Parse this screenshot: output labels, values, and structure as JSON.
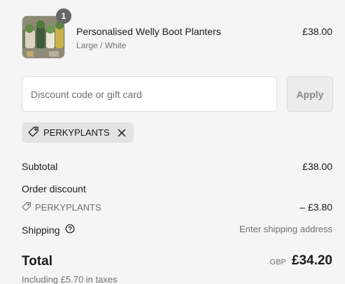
{
  "product": {
    "quantity": "1",
    "title": "Personalised Welly Boot Planters",
    "variant": "Large / White",
    "price": "£38.00"
  },
  "discount": {
    "placeholder": "Discount code or gift card",
    "apply_label": "Apply",
    "applied_code": "PERKYPLANTS"
  },
  "summary": {
    "subtotal_label": "Subtotal",
    "subtotal_value": "£38.00",
    "order_discount_label": "Order discount",
    "order_discount_code": "PERKYPLANTS",
    "order_discount_value": "– £3.80",
    "shipping_label": "Shipping",
    "shipping_value": "Enter shipping address",
    "total_label": "Total",
    "currency": "GBP",
    "total_value": "£34.20",
    "taxes_note": "Including £5.70 in taxes"
  },
  "icons": [
    "tag-icon",
    "close-icon",
    "help-circle-icon"
  ],
  "colors": {
    "background": "#f5f5f5",
    "badge": "#666666",
    "muted_text": "#707070",
    "tag_bg": "#e3e3e3"
  }
}
